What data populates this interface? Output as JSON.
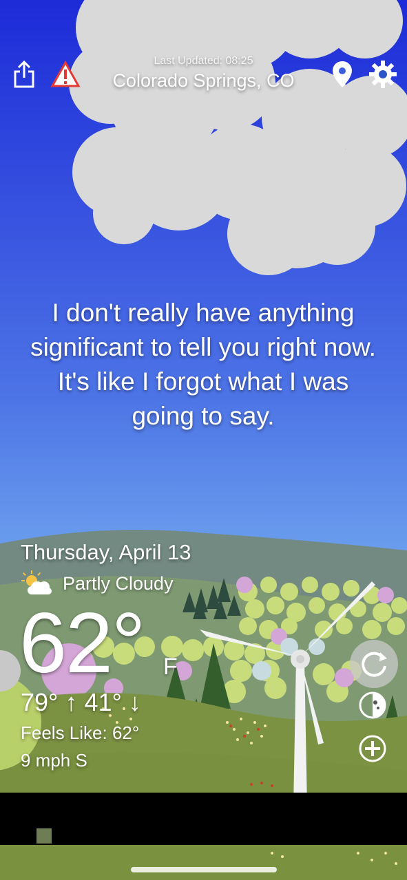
{
  "header": {
    "last_updated": "Last Updated: 08:25",
    "location": "Colorado Springs, CO",
    "icons": [
      "share-icon",
      "alert-icon",
      "location-pin-icon",
      "gear-icon"
    ]
  },
  "message": "I don't really have anything significant to tell you right now. It's like I forgot what I was going to say.",
  "weather": {
    "date": "Thursday, April 13",
    "condition": "Partly Cloudy",
    "temperature": "62°",
    "unit": "F",
    "high": "79° ↑",
    "low": "41° ↓",
    "feels_like": "Feels Like: 62°",
    "wind": "9 mph S"
  },
  "side_buttons": [
    "refresh-icon",
    "radar-icon",
    "add-icon"
  ],
  "colors": {
    "sky_top": "#1a2fd6",
    "sky_bottom": "#6fa6ef",
    "cloud": "#dadada",
    "hill": "#7e9444",
    "tree_dark": "#2f5a2c"
  }
}
